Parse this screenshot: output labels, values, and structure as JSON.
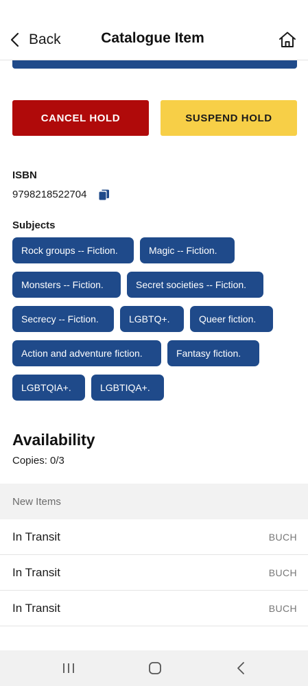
{
  "header": {
    "back_label": "Back",
    "title": "Catalogue Item"
  },
  "actions": {
    "cancel_label": "CANCEL HOLD",
    "suspend_label": "SUSPEND HOLD"
  },
  "details": {
    "isbn_label": "ISBN",
    "isbn_value": "9798218522704",
    "subjects_label": "Subjects",
    "subjects": [
      "Rock groups -- Fiction.",
      "Magic -- Fiction.",
      "Monsters -- Fiction.",
      "Secret societies -- Fiction.",
      "Secrecy -- Fiction.",
      "LGBTQ+.",
      "Queer fiction.",
      "Action and adventure fiction.",
      "Fantasy fiction.",
      "LGBTQIA+.",
      "LGBTIQA+."
    ]
  },
  "availability": {
    "title": "Availability",
    "copies": "Copies: 0/3",
    "group_header": "New Items",
    "items": [
      {
        "status": "In Transit",
        "location": "BUCH"
      },
      {
        "status": "In Transit",
        "location": "BUCH"
      },
      {
        "status": "In Transit",
        "location": "BUCH"
      }
    ]
  },
  "colors": {
    "primary_blue": "#1f4a8a",
    "cancel_red": "#b00a0a",
    "suspend_yellow": "#f7cf47"
  },
  "icons": {
    "back": "chevron-left-icon",
    "home": "home-icon",
    "copy": "copy-icon",
    "nav_recents": "recents-icon",
    "nav_home": "home-circle-icon",
    "nav_back": "back-arrow-icon"
  }
}
